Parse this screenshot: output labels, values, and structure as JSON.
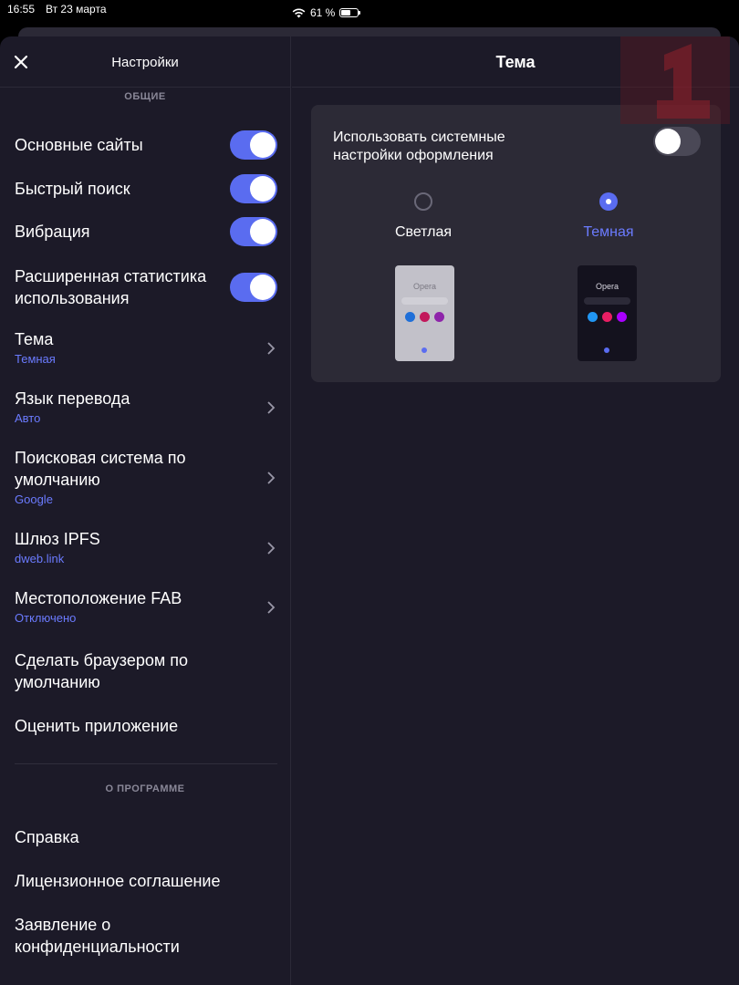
{
  "status": {
    "time": "16:55",
    "date": "Вт 23 марта",
    "battery": "61 %",
    "battery_level": 0.61
  },
  "colors": {
    "accent": "#5a6cf0",
    "background": "#1c1a28",
    "card": "#2c2a36",
    "link": "#6b7bff"
  },
  "left": {
    "title": "Настройки",
    "section_general": "ОБЩИЕ",
    "toggles": [
      {
        "label": "Основные сайты",
        "on": true
      },
      {
        "label": "Быстрый поиск",
        "on": true
      },
      {
        "label": "Вибрация",
        "on": true
      },
      {
        "label": "Расширенная статистика использования",
        "on": true
      }
    ],
    "nav": [
      {
        "label": "Тема",
        "value": "Темная"
      },
      {
        "label": "Язык перевода",
        "value": "Авто"
      },
      {
        "label": "Поисковая система по умолчанию",
        "value": "Google"
      },
      {
        "label": "Шлюз IPFS",
        "value": "dweb.link"
      },
      {
        "label": "Местоположение FAB",
        "value": "Отключено"
      }
    ],
    "actions": [
      {
        "label": "Сделать браузером по умолчанию"
      },
      {
        "label": "Оценить приложение"
      }
    ],
    "section_about": "О ПРОГРАММЕ",
    "about": [
      {
        "label": "Справка"
      },
      {
        "label": "Лицензионное соглашение"
      },
      {
        "label": "Заявление о конфиденциальности"
      }
    ]
  },
  "right": {
    "title": "Тема",
    "system_label": "Использовать системные настройки оформления",
    "system_on": false,
    "options": [
      {
        "label": "Светлая",
        "selected": false,
        "preview_title": "Opera"
      },
      {
        "label": "Темная",
        "selected": true,
        "preview_title": "Opera"
      }
    ],
    "preview_dot_colors": [
      "#1f6fd8",
      "#c2185b",
      "#8e24aa"
    ],
    "preview_dot_colors_dark": [
      "#2196f3",
      "#e91e63",
      "#aa00ff"
    ]
  }
}
